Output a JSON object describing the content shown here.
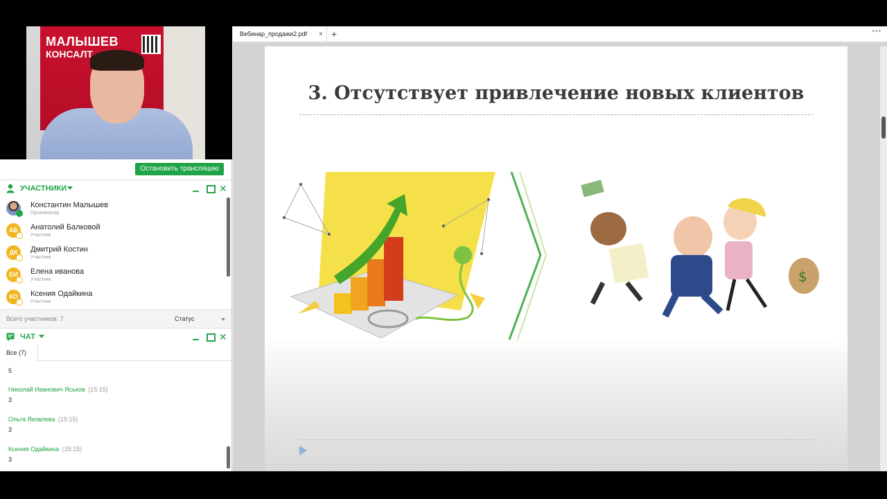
{
  "left_panel": {
    "stop_button_label": "Остановить трансляцию",
    "video": {
      "banner_line1": "МАЛЫШЕВ",
      "banner_line2": "КОНСАЛТ"
    },
    "participants_section": {
      "title": "УЧАСТНИКИ",
      "list": [
        {
          "initials": "",
          "name": "Константин Малышев",
          "role": "Организатор"
        },
        {
          "initials": "АБ",
          "name": "Анатолий Балковой",
          "role": "Участник"
        },
        {
          "initials": "ДК",
          "name": "Дмитрий Костин",
          "role": "Участник"
        },
        {
          "initials": "ЕИ",
          "name": "Елена иванова",
          "role": "Участник"
        },
        {
          "initials": "КО",
          "name": "Ксения Одайкина",
          "role": "Участник"
        }
      ],
      "total_label": "Всего участников: 7",
      "status_select": "Статус"
    },
    "chat_section": {
      "title": "ЧАТ",
      "tab_all": "Все (7)",
      "messages": [
        {
          "author": "",
          "time": "",
          "text": "5"
        },
        {
          "author": "Николай Иванович Яськов",
          "time": "(15:15)",
          "text": "3"
        },
        {
          "author": "Ольга Яковлева",
          "time": "(15:15)",
          "text": "3"
        },
        {
          "author": "Ксения Одайкина",
          "time": "(15:15)",
          "text": "3"
        }
      ]
    }
  },
  "viewer": {
    "tab_name": "Вебинар_продажи2.pdf",
    "tab_close": "×",
    "new_tab": "+",
    "menu": "•••",
    "slide_title": "3. Отсутствует привлечение новых клиентов"
  },
  "colors": {
    "accent_green": "#21a447",
    "avatar_yellow": "#f2b51f"
  }
}
